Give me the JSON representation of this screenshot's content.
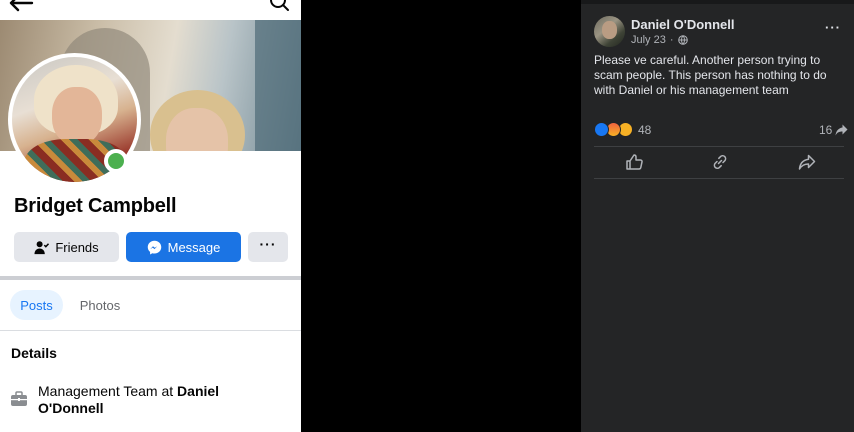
{
  "profile": {
    "name": "Bridget Campbell",
    "buttons": {
      "friends": "Friends",
      "message": "Message",
      "more": "···"
    },
    "tabs": [
      {
        "label": "Posts",
        "active": true
      },
      {
        "label": "Photos",
        "active": false
      }
    ],
    "details_title": "Details",
    "work": {
      "prefix": "Management Team at ",
      "company": "Daniel O'Donnell"
    },
    "status": "online",
    "colors": {
      "accent": "#1b74e4",
      "online": "#4cb04f"
    }
  },
  "post": {
    "author": "Daniel O'Donnell",
    "date": "July 23",
    "separator": "·",
    "privacy_icon": "globe-icon",
    "text": "Please ve careful. Another person trying to scam people. This person has nothing to do with Daniel or his management team",
    "reaction_count": "48",
    "reactions": [
      "like",
      "angry",
      "wow"
    ],
    "share_count": "16",
    "more": "···",
    "actions": [
      "like-icon",
      "link-icon",
      "share-icon"
    ],
    "colors": {
      "background": "#242526",
      "text": "#e4e6eb",
      "muted": "#b0b3b8"
    }
  }
}
